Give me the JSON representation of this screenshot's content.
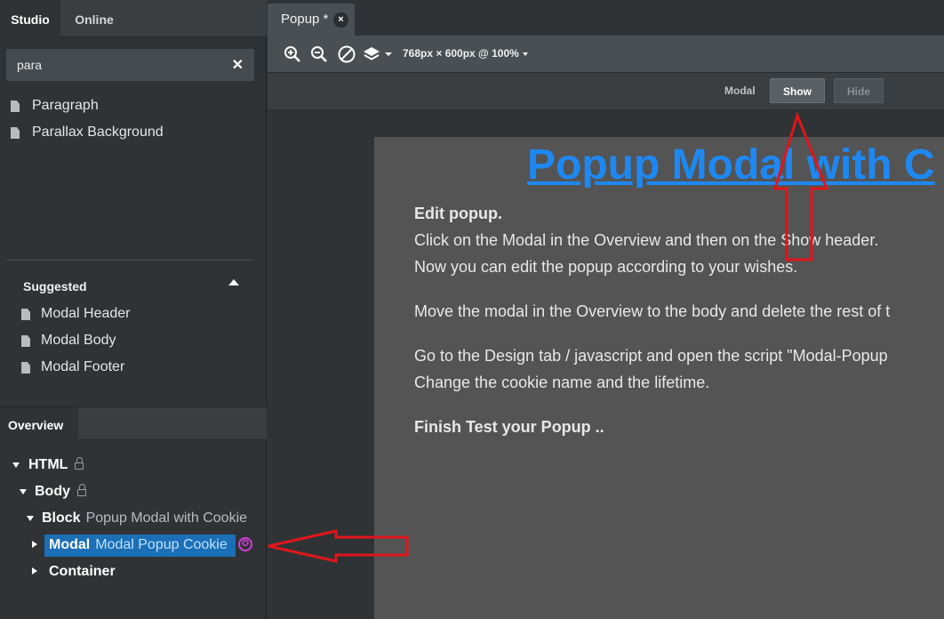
{
  "left_panel": {
    "tabs": [
      {
        "label": "Studio"
      },
      {
        "label": "Online"
      }
    ],
    "search": {
      "value": "para"
    },
    "results": [
      {
        "label": "Paragraph"
      },
      {
        "label": "Parallax Background"
      }
    ],
    "suggested": {
      "title": "Suggested",
      "items": [
        {
          "label": "Modal Header"
        },
        {
          "label": "Modal Body"
        },
        {
          "label": "Modal Footer"
        }
      ]
    },
    "overview": {
      "tab_label": "Overview",
      "tree": [
        {
          "name": "HTML",
          "desc": ""
        },
        {
          "name": "Body",
          "desc": ""
        },
        {
          "name": "Block",
          "desc": "Popup Modal with Cookie"
        },
        {
          "name": "Modal",
          "desc": "Modal Popup Cookie"
        },
        {
          "name": "Container",
          "desc": ""
        }
      ]
    }
  },
  "editor": {
    "tab": {
      "label": "Popup *",
      "close": "×"
    },
    "toolbar": {
      "size_label": "768px × 600px @ 100%"
    },
    "modal_bar": {
      "label": "Modal",
      "show": "Show",
      "hide": "Hide"
    }
  },
  "page": {
    "title": "Popup Modal with C",
    "lines": [
      "Edit popup.",
      "Click on the Modal in the Overview and then on the Show header.",
      "Now you can edit the popup according to your wishes.",
      "Move the modal in the Overview to the body and delete the rest of t",
      "Go to the Design tab / javascript and open the script \"Modal-Popup",
      "Change the cookie name and the lifetime.",
      "Finish Test your Popup .."
    ]
  },
  "colors": {
    "accent": "#1a6fb6",
    "link": "#1e88f2",
    "arrow": "#e0151b",
    "badge": "#d63bd6"
  }
}
